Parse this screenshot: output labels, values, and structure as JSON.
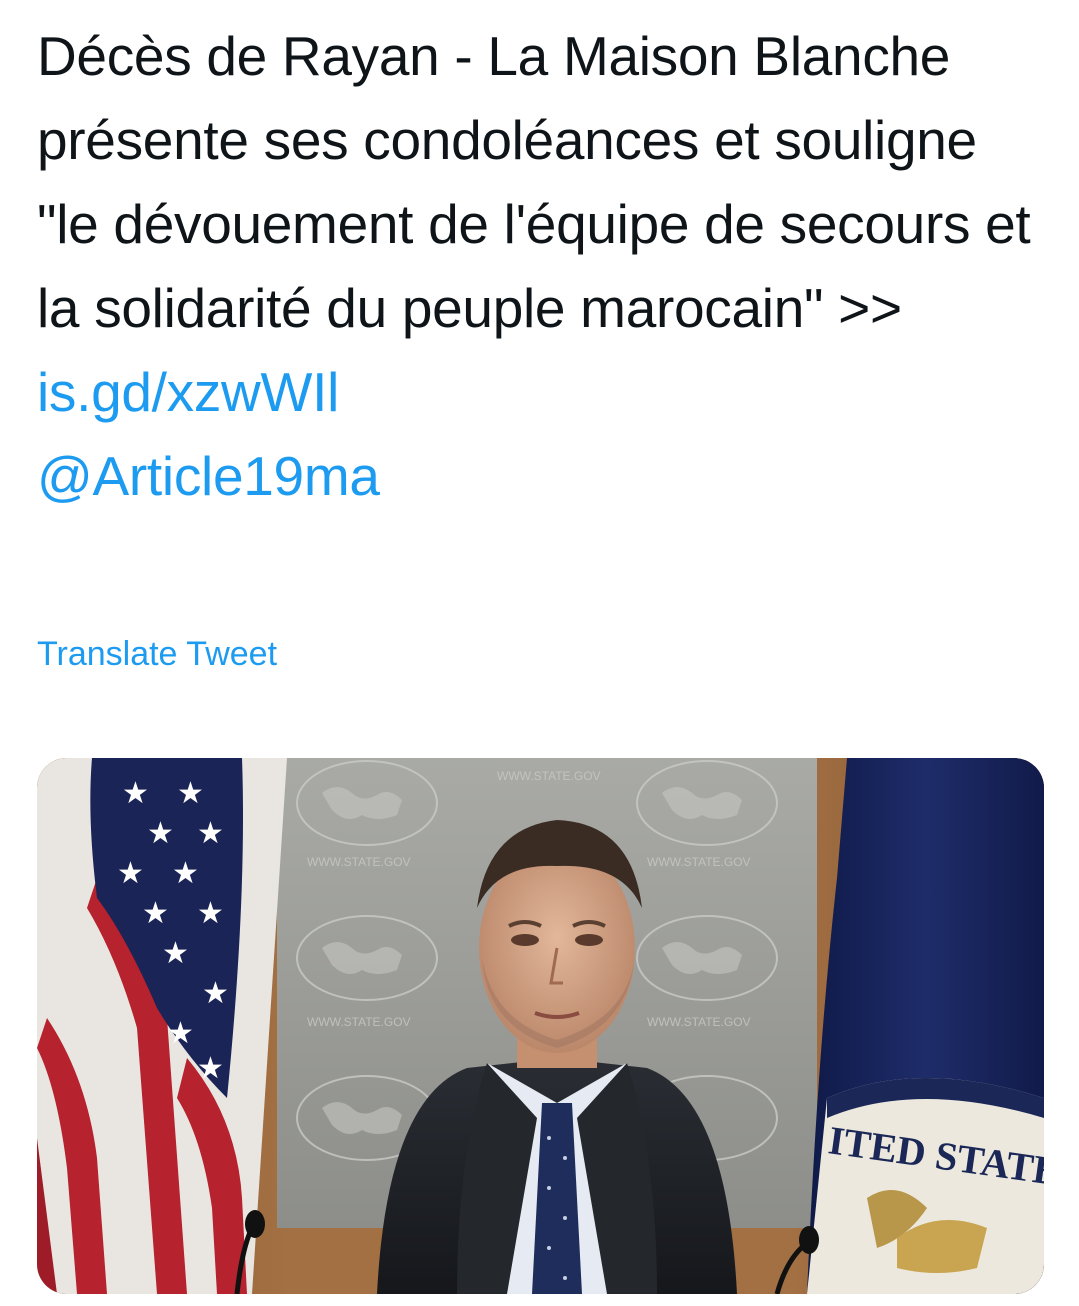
{
  "tweet": {
    "text_before_link": "Décès de Rayan - La Maison Blanche présente ses condoléances et souligne \"le dévouement de l'équipe de secours et la solidarité du peuple marocain\" >> ",
    "link": "is.gd/xzwWIl",
    "mention": "@Article19ma",
    "translate_label": "Translate Tweet"
  },
  "media": {
    "alt_icons": [
      "us-flag-icon",
      "state-department-seal-icon",
      "microphone-icon"
    ],
    "seal_text": "ITED STATES",
    "backdrop_text": "WWW.STATE.GOV"
  },
  "colors": {
    "text": "#0f1419",
    "link": "#1d9bf0",
    "background": "#ffffff"
  }
}
